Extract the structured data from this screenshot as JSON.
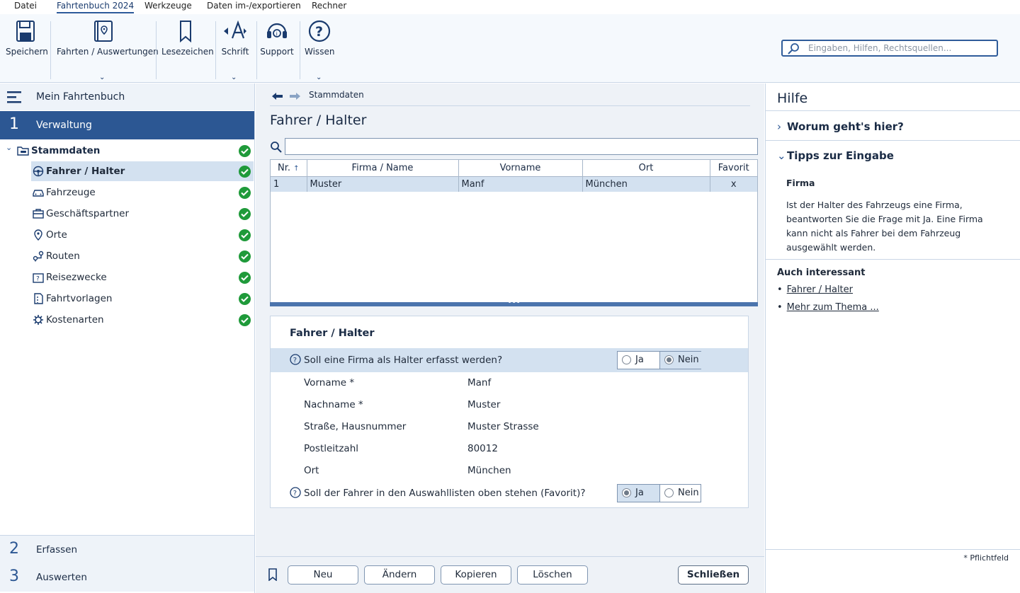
{
  "menu": [
    "Datei",
    "Fahrtenbuch 2024",
    "Werkzeuge",
    "Daten im-/exportieren",
    "Rechner"
  ],
  "ribbon": {
    "save": "Speichern",
    "trips": "Fahrten / Auswertungen",
    "bookmarks": "Lesezeichen",
    "font": "Schrift",
    "support": "Support",
    "knowledge": "Wissen"
  },
  "search": {
    "placeholder": "Eingaben, Hilfen, Rechtsquellen..."
  },
  "nav": {
    "header": "Mein Fahrtenbuch",
    "section1": {
      "num": "1",
      "label": "Verwaltung"
    },
    "root": "Stammdaten",
    "items": [
      "Fahrer / Halter",
      "Fahrzeuge",
      "Geschäftspartner",
      "Orte",
      "Routen",
      "Reisezwecke",
      "Fahrtvorlagen",
      "Kostenarten"
    ],
    "section2": {
      "num": "2",
      "label": "Erfassen"
    },
    "section3": {
      "num": "3",
      "label": "Auswerten"
    }
  },
  "main": {
    "breadcrumb": "Stammdaten",
    "title": "Fahrer / Halter",
    "grid": {
      "columns": [
        "Nr.",
        "Firma / Name",
        "Vorname",
        "Ort",
        "Favorit"
      ],
      "rows": [
        [
          "1",
          "Muster",
          "Manf",
          "München",
          "x"
        ]
      ]
    },
    "detail": {
      "title": "Fahrer / Halter",
      "q1": "Soll eine Firma als Halter erfasst werden?",
      "q1_selected": "Nein",
      "fields": [
        {
          "label": "Vorname *",
          "value": "Manf"
        },
        {
          "label": "Nachname *",
          "value": "Muster"
        },
        {
          "label": "Straße, Hausnummer",
          "value": "Muster Strasse"
        },
        {
          "label": "Postleitzahl",
          "value": "80012"
        },
        {
          "label": "Ort",
          "value": "München"
        }
      ],
      "q2": "Soll der Fahrer in den Auswahllisten oben stehen (Favorit)?",
      "q2_selected": "Ja",
      "yes": "Ja",
      "no": "Nein"
    },
    "buttons": {
      "new": "Neu",
      "edit": "Ändern",
      "copy": "Kopieren",
      "delete": "Löschen",
      "close": "Schließen"
    }
  },
  "help": {
    "title": "Hilfe",
    "acc1": "Worum geht's hier?",
    "acc2": "Tipps zur Eingabe",
    "subtitle": "Firma",
    "text": "Ist der Halter des Fahrzeugs eine Firma, beantworten Sie die Frage mit Ja. Eine Firma kann nicht als Fahrer bei dem Fahrzeug ausgewählt werden.",
    "also": "Auch interessant",
    "links": [
      "Fahrer / Halter",
      "Mehr zum Thema ..."
    ],
    "required_note": "* Pflichtfeld"
  }
}
